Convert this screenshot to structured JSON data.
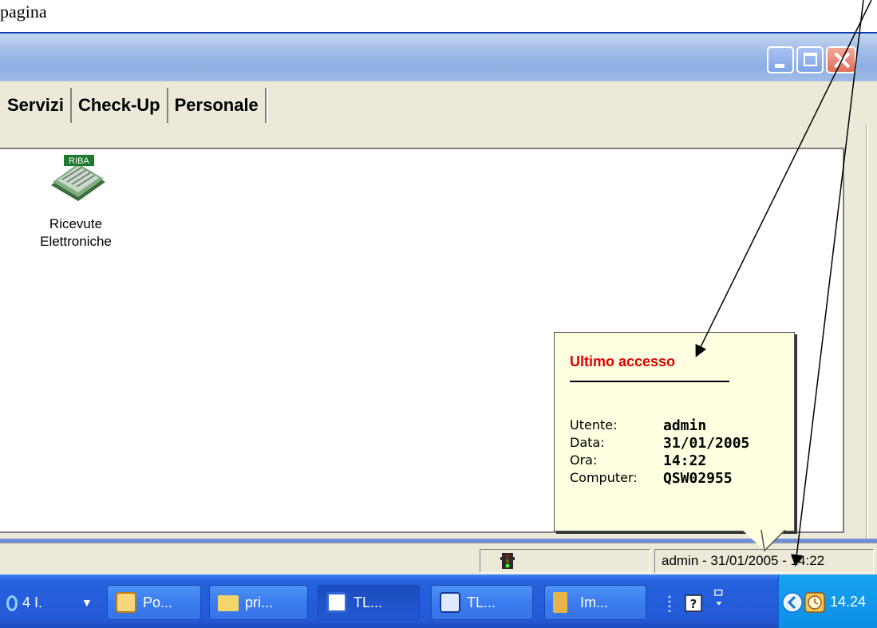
{
  "top_text": "pagina",
  "window": {
    "buttons": {
      "minimize": "minimize-button",
      "maximize": "maximize-button",
      "close": "close-button"
    }
  },
  "tabs": [
    "Servizi",
    "Check-Up",
    "Personale"
  ],
  "content": {
    "icon_badge": "RIBA",
    "icon_label_line1": "Ricevute",
    "icon_label_line2": "Elettroniche"
  },
  "tooltip": {
    "title": "Ultimo accesso",
    "rows": [
      {
        "key": "Utente:",
        "value": "admin"
      },
      {
        "key": "Data:",
        "value": "31/01/2005"
      },
      {
        "key": "Ora:",
        "value": "14:22"
      },
      {
        "key": "Computer:",
        "value": "QSW02955"
      }
    ]
  },
  "statusbar": {
    "login_text": "admin - 31/01/2005 - 14:22",
    "light_icon": "traffic-light-icon"
  },
  "taskbar": {
    "first_label": "4 I.",
    "buttons": [
      {
        "label": "Po...",
        "icon": "clock-app-icon"
      },
      {
        "label": "pri...",
        "icon": "folder-icon"
      },
      {
        "label": "TL...",
        "icon": "app-icon"
      },
      {
        "label": "TL...",
        "icon": "screen-app-icon"
      },
      {
        "label": "Im...",
        "icon": "paint-icon"
      }
    ],
    "clock": "14.24"
  },
  "colors": {
    "accent_red": "#e00000",
    "taskbar_blue": "#2459d6",
    "tooltip_bg": "#ffffe1"
  }
}
